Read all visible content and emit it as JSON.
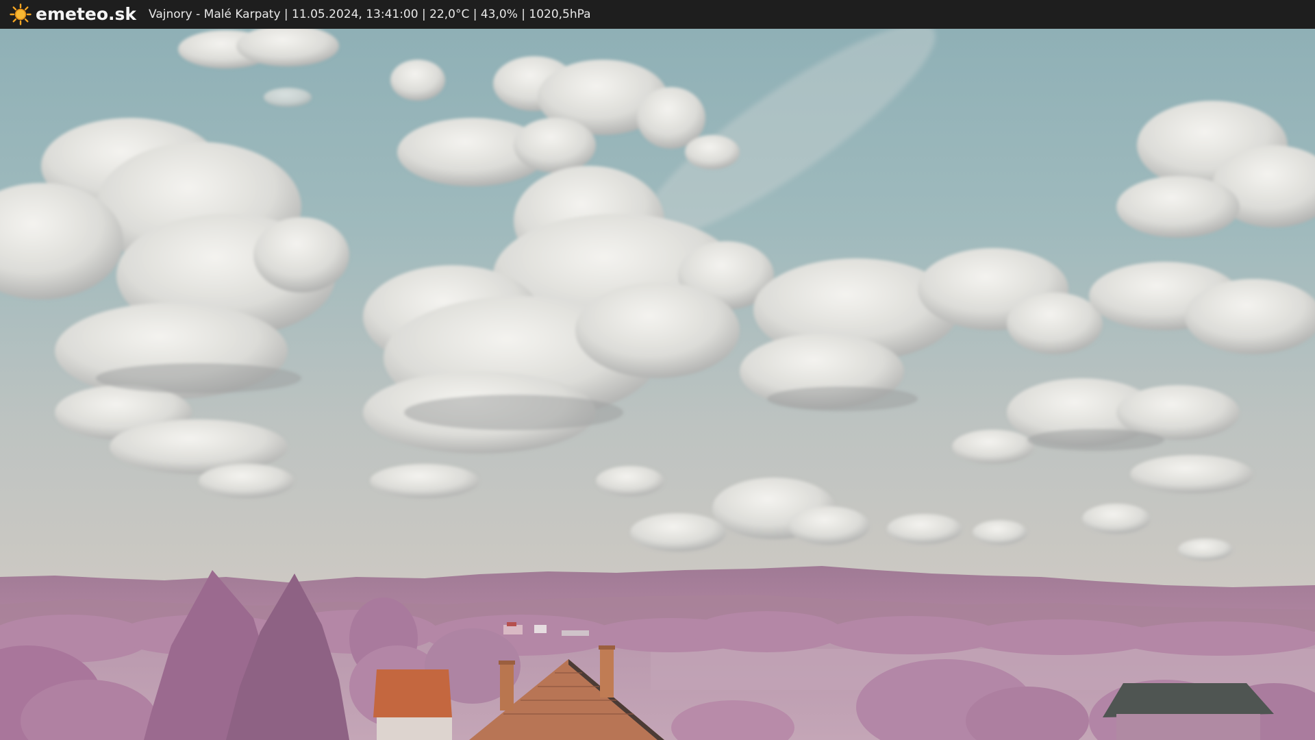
{
  "window": {
    "brand": "emeteo.sk",
    "caption": "Vajnory - Malé Karpaty | 11.05.2024, 13:41:00 | 22,0°C | 43,0% | 1020,5hPa"
  },
  "icons": {
    "logo": "sun-icon"
  },
  "colors": {
    "topbar": "#1e1e1e",
    "sun": "#f5a623",
    "sky_top": "#8fb1b8",
    "sky_bottom": "#c9c7c2",
    "foliage": "#b582a6",
    "roof": "#b8623e"
  }
}
